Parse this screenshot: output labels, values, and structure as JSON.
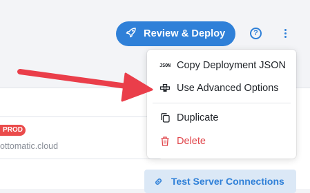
{
  "toolbar": {
    "review_deploy_label": "Review & Deploy",
    "help_label": "?"
  },
  "menu": {
    "items": [
      {
        "label": "Copy Deployment JSON",
        "icon": "json-icon",
        "icon_text": "JSON"
      },
      {
        "label": "Use Advanced Options",
        "icon": "advanced-options-icon"
      },
      {
        "label": "Duplicate",
        "icon": "duplicate-icon"
      },
      {
        "label": "Delete",
        "icon": "trash-icon"
      }
    ]
  },
  "server": {
    "badge": "PROD",
    "host": "ottomatic.cloud"
  },
  "actions": {
    "test_connections_label": "Test Server Connections"
  },
  "colors": {
    "accent": "#2f80d8",
    "danger": "#e0454a",
    "annotation_arrow": "#ea3e4a"
  }
}
